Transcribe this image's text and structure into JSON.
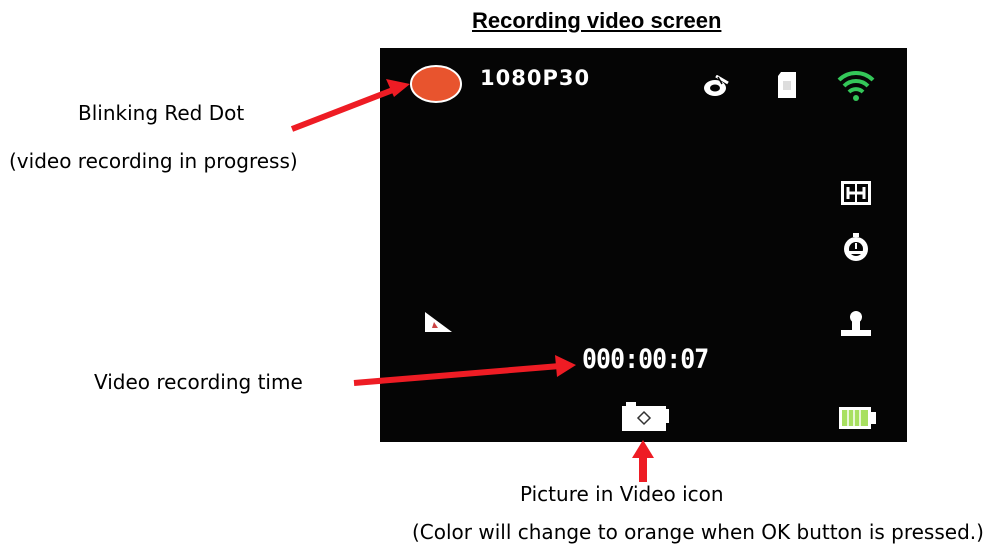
{
  "title": "Recording video screen",
  "annotations": {
    "red_dot_line1": "Blinking Red Dot",
    "red_dot_line2": "(video recording in progress)",
    "recording_time": "Video recording time",
    "piv_line1": "Picture in Video icon",
    "piv_line2": "(Color will change to orange when OK button is pressed.)"
  },
  "screen": {
    "resolution": "1080P30",
    "timer": "000:00:07",
    "icons": {
      "record_dot": "recording-dot-icon",
      "top": [
        "motion-detect-icon",
        "sd-card-icon",
        "wifi-icon"
      ],
      "right": [
        "auto-exposure-icon",
        "self-timer-icon",
        "image-stabilization-icon",
        "battery-icon"
      ],
      "left": [
        "wide-angle-icon"
      ],
      "bottom": [
        "picture-in-video-icon"
      ]
    },
    "colors": {
      "record_dot": "#e8542e",
      "wifi": "#34c759",
      "battery": "#a8e060",
      "arrow": "#ee1c24",
      "background": "#050505"
    }
  }
}
